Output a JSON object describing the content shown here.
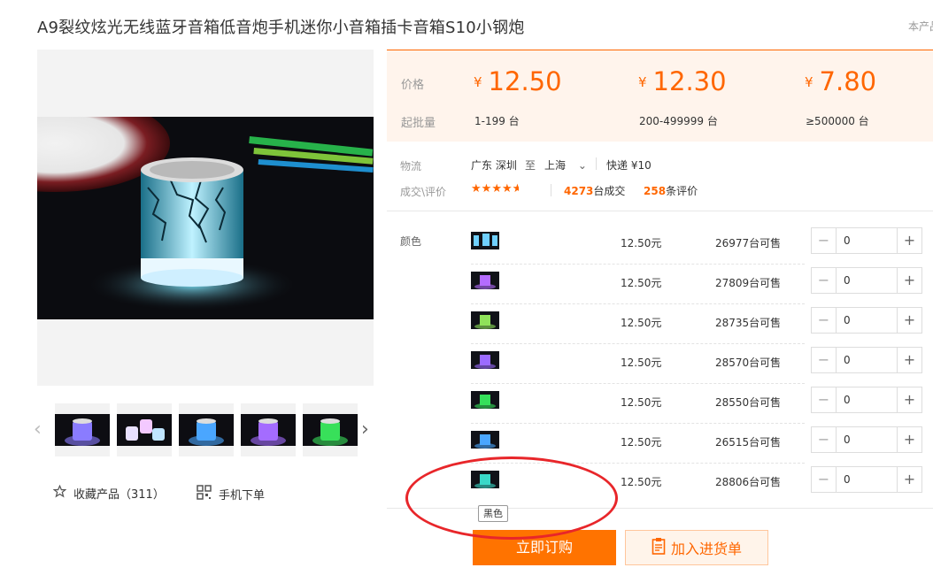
{
  "product": {
    "title": "A9裂纹炫光无线蓝牙音箱低音炮手机迷你小音箱插卡音箱S10小钢炮",
    "aside": "本产品"
  },
  "gallery": {
    "thumbnails": [
      {
        "alt": "thumbnail 1",
        "glow": "#8a7cff"
      },
      {
        "alt": "thumbnail 2",
        "glow": "#d9d6ff"
      },
      {
        "alt": "thumbnail 3",
        "glow": "#4aa6ff"
      },
      {
        "alt": "thumbnail 4",
        "glow": "#a46cff"
      },
      {
        "alt": "thumbnail 5",
        "glow": "#38e05a"
      }
    ],
    "favorite_label": "收藏产品（311）",
    "mobile_order_label": "手机下单"
  },
  "pricing": {
    "price_label": "价格",
    "moq_label": "起批量",
    "currency": "¥",
    "tiers": [
      {
        "price": "12.50",
        "range": "1-199 台"
      },
      {
        "price": "12.30",
        "range": "200-499999 台"
      },
      {
        "price": "7.80",
        "range": "≥500000 台"
      }
    ]
  },
  "logistics": {
    "label": "物流",
    "origin": "广东 深圳",
    "to": "至",
    "destination": "上海",
    "method": "快递 ¥10"
  },
  "reviews": {
    "label": "成交\\评价",
    "rating": 4.5,
    "deals_count": "4273",
    "deals_suffix": "台成交",
    "review_count": "258",
    "review_suffix": "条评价"
  },
  "sku": {
    "label": "颜色",
    "items": [
      {
        "price": "12.50元",
        "stock": "26977台可售",
        "qty": "0",
        "glow": "#6fd0ff"
      },
      {
        "price": "12.50元",
        "stock": "27809台可售",
        "qty": "0",
        "glow": "#b46cff"
      },
      {
        "price": "12.50元",
        "stock": "28735台可售",
        "qty": "0",
        "glow": "#8fe25a"
      },
      {
        "price": "12.50元",
        "stock": "28570台可售",
        "qty": "0",
        "glow": "#9b6bff"
      },
      {
        "price": "12.50元",
        "stock": "28550台可售",
        "qty": "0",
        "glow": "#35e05a"
      },
      {
        "price": "12.50元",
        "stock": "26515台可售",
        "qty": "0",
        "glow": "#4aa6ff"
      },
      {
        "price": "12.50元",
        "stock": "28806台可售",
        "qty": "0",
        "glow": "#39d8c8"
      }
    ],
    "tooltip": "黑色"
  },
  "actions": {
    "buy_now": "立即订购",
    "add_to_list": "加入进货单"
  },
  "colors": {
    "accent": "#ff6600",
    "price_bg": "#fff4ec",
    "annotation": "#e8262a"
  }
}
